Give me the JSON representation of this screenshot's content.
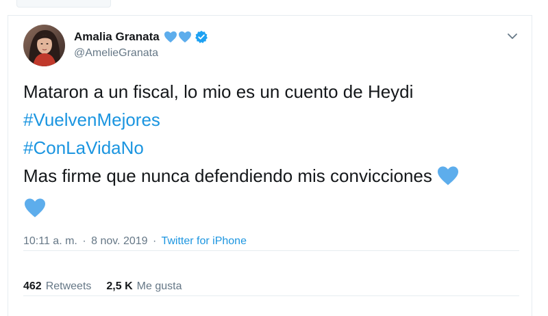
{
  "user": {
    "name": "Amalia Granata",
    "handle": "@AmelieGranata",
    "name_hearts": [
      "blue-heart-icon",
      "blue-heart-icon"
    ],
    "verified_icon": "verified-badge-icon"
  },
  "tweet": {
    "lines": [
      "Mataron a un fiscal, lo mio es un cuento de Heydi",
      "#VuelvenMejores",
      "#ConLaVidaNo",
      "Mas firme que nunca defendiendo mis convicciones"
    ],
    "trailing_emoji": [
      "blue-heart-icon",
      "blue-heart-icon"
    ]
  },
  "meta": {
    "time": "10:11 a. m.",
    "separator": "·",
    "date": "8 nov. 2019",
    "source": "Twitter for iPhone"
  },
  "stats": {
    "retweets_count": "462",
    "retweets_label": "Retweets",
    "likes_count": "2,5 K",
    "likes_label": "Me gusta"
  },
  "colors": {
    "link": "#1b95e0",
    "heart": "#5dadec",
    "verified": "#1da1f2",
    "muted": "#657786"
  },
  "menu_icon": "chevron-down-icon"
}
